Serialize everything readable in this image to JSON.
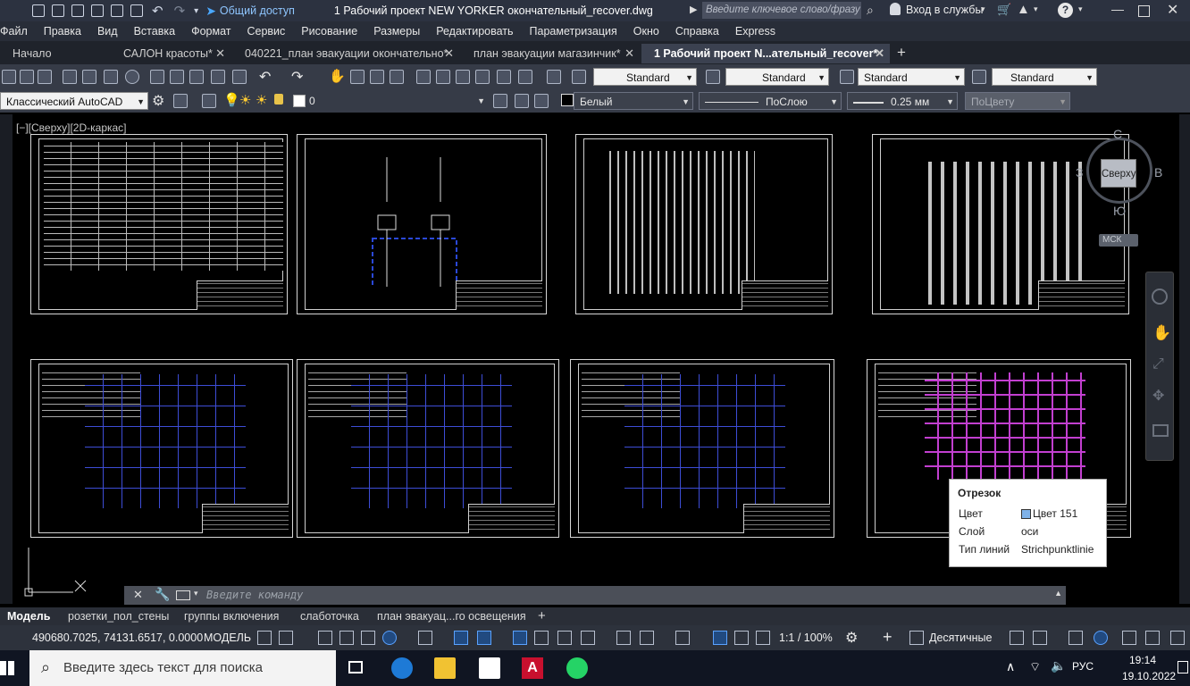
{
  "titlebar": {
    "share_label": "Общий доступ",
    "title": "1 Рабочий проект NEW YORKER окончательный_recover.dwg",
    "search_placeholder": "Введите ключевое слово/фразу",
    "signin_label": "Вход в службы"
  },
  "menu": [
    "Файл",
    "Правка",
    "Вид",
    "Вставка",
    "Формат",
    "Сервис",
    "Рисование",
    "Размеры",
    "Редактировать",
    "Параметризация",
    "Окно",
    "Справка",
    "Express"
  ],
  "doc_tabs": [
    {
      "label": "Начало"
    },
    {
      "label": "САЛОН красоты*"
    },
    {
      "label": "040221_план эвакуации окончательно*"
    },
    {
      "label": "план эвакуации магазинчик*"
    },
    {
      "label": "1 Рабочий проект N...ательный_recover*"
    }
  ],
  "toolbar1": {
    "styles": [
      "Standard",
      "Standard",
      "Standard",
      "Standard"
    ]
  },
  "toolbar2": {
    "workspace": "Классический AutoCAD",
    "layer": "0",
    "color": "Белый",
    "linetype": "ПоСлою",
    "lineweight": "0.25 мм",
    "plotstyle": "ПоЦвету"
  },
  "viewport_label": "[−][Сверху][2D-каркас]",
  "viewcube": {
    "top": "Сверху",
    "north": "С",
    "east": "В",
    "south": "Ю",
    "west": "З",
    "ucs": "МСК"
  },
  "tooltip": {
    "title": "Отрезок",
    "rows": [
      {
        "key": "Цвет",
        "value": "Цвет 151"
      },
      {
        "key": "Слой",
        "value": "оси"
      },
      {
        "key": "Тип линий",
        "value": "Strichpunktlinie"
      }
    ],
    "swatch_color": "#7fb2e8"
  },
  "command": {
    "placeholder": "Введите команду"
  },
  "layout_tabs": [
    "Модель",
    "розетки_пол_стены",
    "группы включения",
    "слаботочка",
    "план эвакуац...го освещения"
  ],
  "status": {
    "coords": "490680.7025, 74131.6517, 0.0000",
    "space": "МОДЕЛЬ",
    "scale": "1:1 / 100%",
    "units": "Десятичные"
  },
  "taskbar": {
    "search_placeholder": "Введите здесь текст для поиска",
    "lang": "РУС",
    "time": "19:14",
    "date": "19.10.2022"
  }
}
